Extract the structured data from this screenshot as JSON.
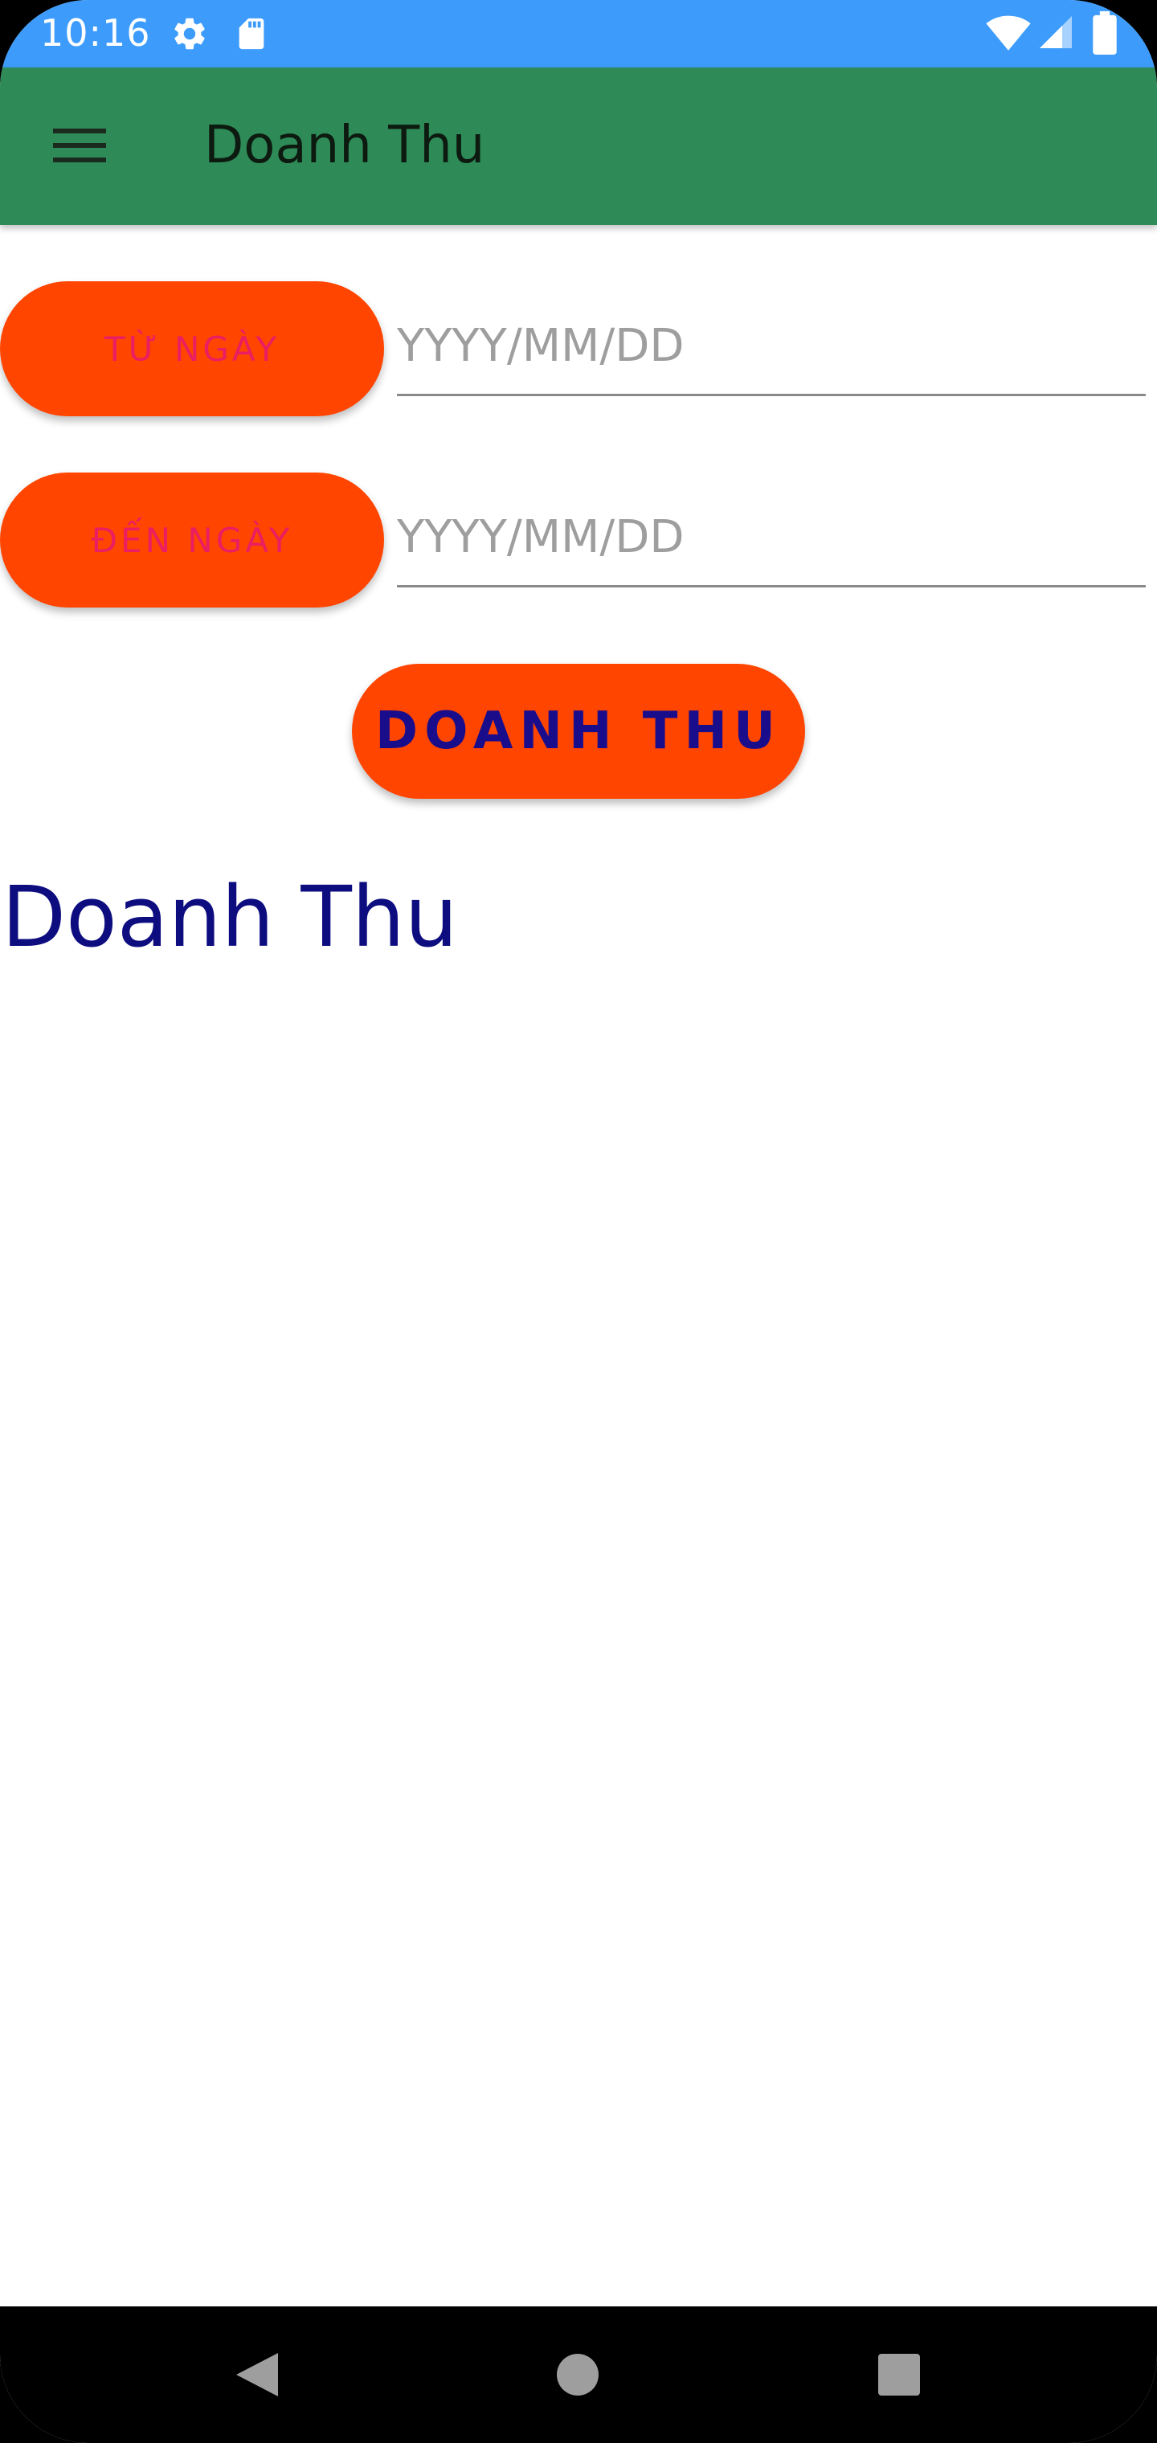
{
  "status_bar": {
    "time": "10:16",
    "icons": [
      "gear-icon",
      "sd-card-icon",
      "wifi-icon",
      "signal-icon",
      "battery-icon"
    ],
    "color": "#3d9cfb"
  },
  "app_bar": {
    "title": "Doanh Thu",
    "menu_icon": "hamburger-menu-icon",
    "color": "#2e8b57"
  },
  "form": {
    "from_date": {
      "button_label": "TỪ NGÀY",
      "placeholder": "YYYY/MM/DD",
      "value": ""
    },
    "to_date": {
      "button_label": "ĐẾN NGÀY",
      "placeholder": "YYYY/MM/DD",
      "value": ""
    },
    "submit_label": "DOANH THU",
    "button_color": "#ff4500"
  },
  "result": {
    "label": "Doanh Thu"
  },
  "nav_bar": {
    "icons": [
      "back-icon",
      "home-icon",
      "recents-icon"
    ]
  }
}
